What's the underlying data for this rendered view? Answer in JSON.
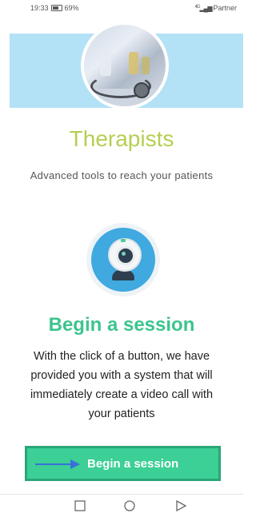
{
  "status": {
    "time": "19:33",
    "battery": "69%",
    "network": "4G",
    "carrier": "Partner"
  },
  "hero": {
    "title": "Therapists",
    "subtitle": "Advanced tools to reach your patients",
    "image_icon": "medical-photo"
  },
  "feature": {
    "icon": "webcam-icon",
    "title": "Begin a session",
    "description": "With the click of a button, we have provided you with a system that will immediately create a video call with your patients"
  },
  "cta": {
    "label": "Begin a session",
    "icon": "arrow-right-icon"
  },
  "nav": {
    "recent_icon": "square-icon",
    "home_icon": "circle-icon",
    "back_icon": "triangle-icon"
  },
  "colors": {
    "hero_band": "#b3e1f6",
    "therapists_title": "#b4cf52",
    "session_title": "#3cc48f",
    "cta_bg": "#3ccf96",
    "cta_border": "#2aa676",
    "arrow": "#3a6fd8",
    "webcam_bg": "#3fa9e0"
  }
}
